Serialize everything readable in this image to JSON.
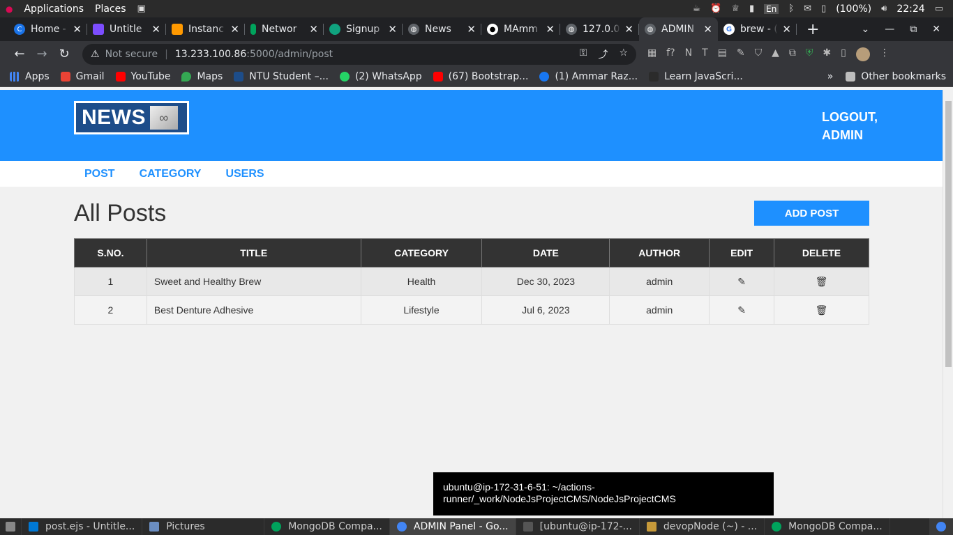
{
  "os_panel": {
    "menu_applications": "Applications",
    "menu_places": "Places",
    "battery": "(100%)",
    "language": "En",
    "clock": "22:24"
  },
  "tabs": [
    {
      "title": "Home -",
      "color": "#1a73e8"
    },
    {
      "title": "Untitle",
      "color": "#7c4dff"
    },
    {
      "title": "Instanc",
      "color": "#ff9900"
    },
    {
      "title": "Networ",
      "color": "#00a35c"
    },
    {
      "title": "Signup",
      "color": "#10a37f"
    },
    {
      "title": "News",
      "color": "#5f6368"
    },
    {
      "title": "MAmm",
      "color": "#24292e"
    },
    {
      "title": "127.0.0",
      "color": "#5f6368"
    },
    {
      "title": "ADMIN",
      "color": "#5f6368"
    },
    {
      "title": "brew - (",
      "color": "#4285f4"
    }
  ],
  "address_bar": {
    "security": "Not secure",
    "host": "13.233.100.86",
    "path": ":5000/admin/post"
  },
  "bookmarks": [
    {
      "label": "Apps",
      "color": "#4285f4"
    },
    {
      "label": "Gmail",
      "color": "#ea4335"
    },
    {
      "label": "YouTube",
      "color": "#ff0000"
    },
    {
      "label": "Maps",
      "color": "#34a853"
    },
    {
      "label": "NTU Student –...",
      "color": "#1d4d8a"
    },
    {
      "label": "(2) WhatsApp",
      "color": "#25d366"
    },
    {
      "label": "(67) Bootstrap...",
      "color": "#ff0000"
    },
    {
      "label": "(1) Ammar Raz...",
      "color": "#1877f2"
    },
    {
      "label": "Learn JavaScri...",
      "color": "#2b2b2b"
    }
  ],
  "other_bookmarks": "Other bookmarks",
  "site": {
    "logo_text": "NEWS",
    "logout": "LOGOUT, ADMIN",
    "menu": [
      "POST",
      "CATEGORY",
      "USERS"
    ],
    "page_title": "All Posts",
    "add_post": "ADD POST",
    "columns": [
      "S.NO.",
      "TITLE",
      "CATEGORY",
      "DATE",
      "AUTHOR",
      "EDIT",
      "DELETE"
    ],
    "rows": [
      {
        "sno": "1",
        "title": "Sweet and Healthy Brew",
        "category": "Health",
        "date": "Dec 30, 2023",
        "author": "admin"
      },
      {
        "sno": "2",
        "title": "Best Denture Adhesive",
        "category": "Lifestyle",
        "date": "Jul 6, 2023",
        "author": "admin"
      }
    ],
    "accent_color": "#1e90ff"
  },
  "tooltip": "ubuntu@ip-172-31-6-51: ~/actions-runner/_work/NodeJsProjectCMS/NodeJsProjectCMS",
  "taskbar": [
    {
      "label": "post.ejs - Untitle...",
      "icon": "vscode-icon",
      "color": "#0078d4"
    },
    {
      "label": "Pictures",
      "icon": "folder-icon",
      "color": "#6b8ec2"
    },
    {
      "label": "MongoDB Compa...",
      "icon": "mongodb-icon",
      "color": "#00a35c"
    },
    {
      "label": "ADMIN Panel - Go...",
      "icon": "chrome-icon",
      "color": "#4285f4"
    },
    {
      "label": "[ubuntu@ip-172-...",
      "icon": "terminal-icon",
      "color": "#555555"
    },
    {
      "label": "devopNode (~) - ...",
      "icon": "editor-icon",
      "color": "#c79a3a"
    },
    {
      "label": "MongoDB Compa...",
      "icon": "mongodb-icon",
      "color": "#00a35c"
    }
  ]
}
